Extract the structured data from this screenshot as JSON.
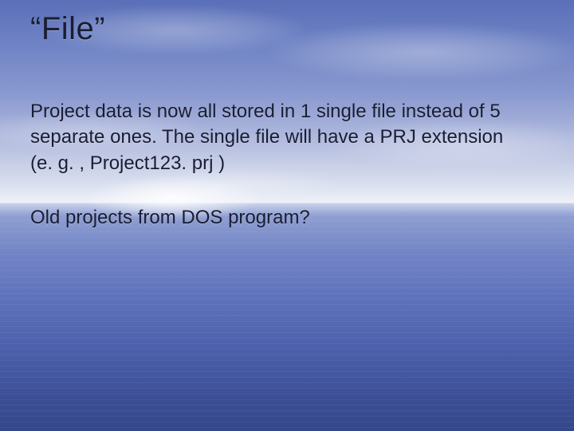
{
  "title": "“File”",
  "paragraphs": [
    "Project data is now all stored in 1 single file instead of 5 separate ones. The single file will have a PRJ extension (e. g. , Project123. prj )",
    "Old projects from DOS program?"
  ]
}
